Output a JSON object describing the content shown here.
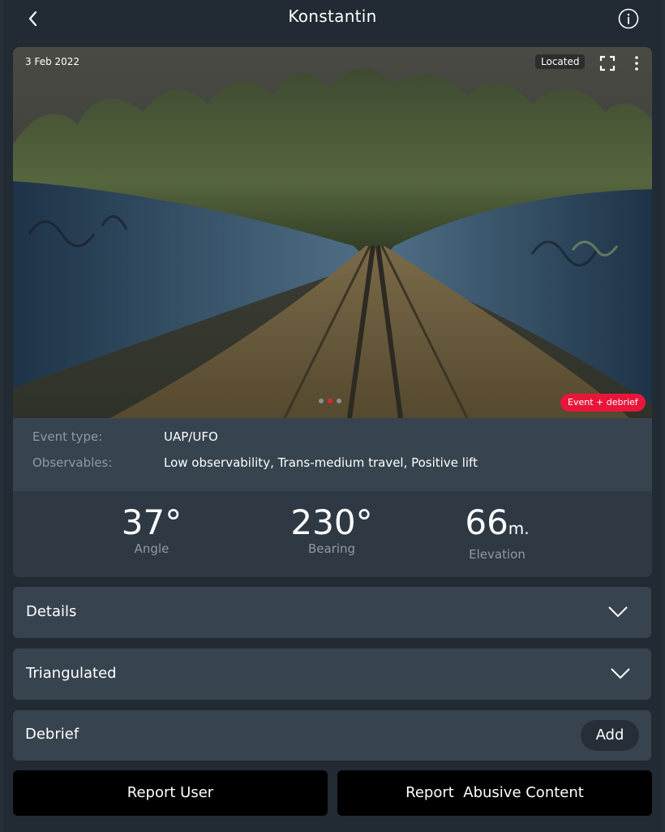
{
  "header": {
    "title": "Konstantin",
    "back_icon": "chevron-left-icon",
    "info_icon": "info-circle-icon"
  },
  "photo": {
    "date": "3 Feb 2022",
    "located_label": "Located",
    "event_badge": "Event + debrief",
    "expand_icon": "fullscreen-icon",
    "more_icon": "more-vertical-icon",
    "carousel_total": 3,
    "carousel_active": 2
  },
  "meta": {
    "event_type_label": "Event type:",
    "event_type_value": "UAP/UFO",
    "observables_label": "Observables:",
    "observables_value": "Low observability, Trans-medium travel, Positive lift"
  },
  "stats": {
    "angle_value": "37°",
    "angle_label": "Angle",
    "bearing_value": "230°",
    "bearing_label": "Bearing",
    "elevation_value": "66",
    "elevation_unit": "m.",
    "elevation_label": "Elevation"
  },
  "sections": {
    "details": "Details",
    "triangulated": "Triangulated",
    "debrief": "Debrief",
    "add": "Add"
  },
  "actions": {
    "report_user": "Report User",
    "report_content": "Report  Abusive Content"
  },
  "colors": {
    "background": "#222b33",
    "card": "#37444f",
    "accent_red": "#e8163b"
  }
}
